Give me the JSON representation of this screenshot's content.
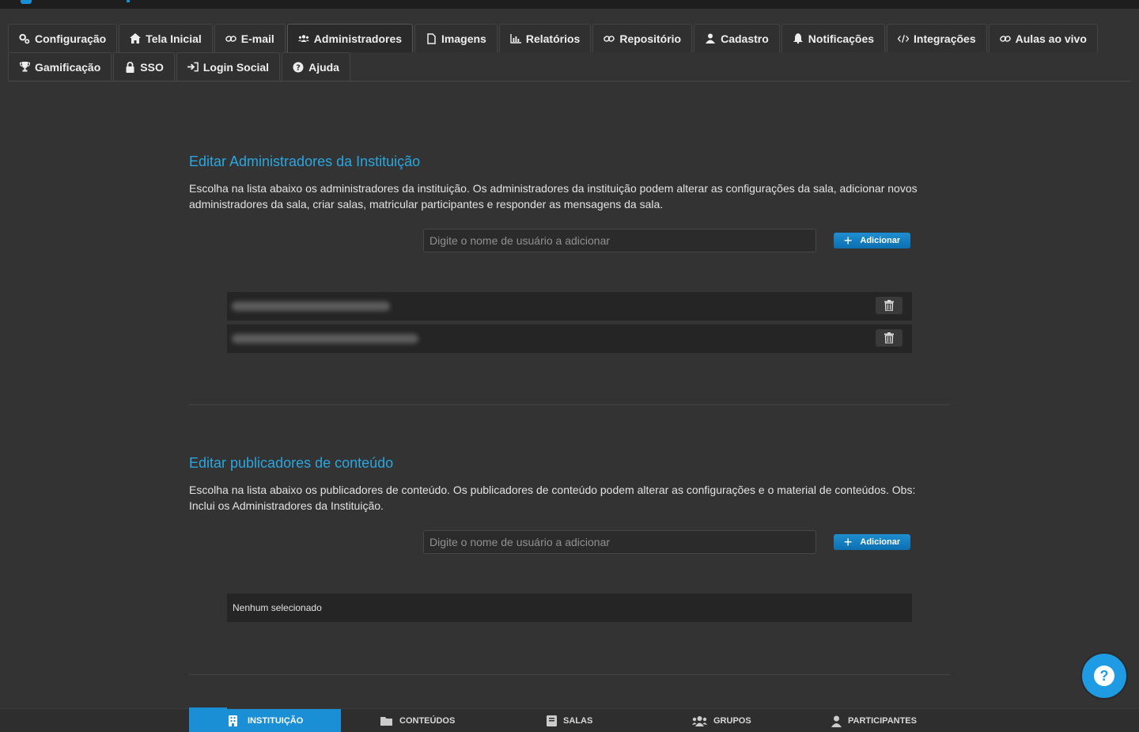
{
  "tabs": {
    "row1": [
      {
        "label": "Configuração",
        "icon": "gears-icon",
        "name": "tab-configuracao"
      },
      {
        "label": "Tela Inicial",
        "icon": "home-icon",
        "name": "tab-tela-inicial"
      },
      {
        "label": "E-mail",
        "icon": "link-icon",
        "name": "tab-email"
      },
      {
        "label": "Administradores",
        "icon": "users-icon",
        "name": "tab-administradores",
        "active": true
      },
      {
        "label": "Imagens",
        "icon": "file-icon",
        "name": "tab-imagens"
      },
      {
        "label": "Relatórios",
        "icon": "bar-chart-icon",
        "name": "tab-relatorios"
      },
      {
        "label": "Repositório",
        "icon": "link-icon",
        "name": "tab-repositorio"
      },
      {
        "label": "Cadastro",
        "icon": "user-icon",
        "name": "tab-cadastro"
      },
      {
        "label": "Notificações",
        "icon": "bell-icon",
        "name": "tab-notificacoes"
      },
      {
        "label": "Integrações",
        "icon": "code-icon",
        "name": "tab-integracoes"
      },
      {
        "label": "Aulas ao vivo",
        "icon": "link-icon",
        "name": "tab-aulas-ao-vivo"
      }
    ],
    "row2": [
      {
        "label": "Gamificação",
        "icon": "trophy-icon",
        "name": "tab-gamificacao"
      },
      {
        "label": "SSO",
        "icon": "lock-icon",
        "name": "tab-sso"
      },
      {
        "label": "Login Social",
        "icon": "sign-in-icon",
        "name": "tab-login-social"
      },
      {
        "label": "Ajuda",
        "icon": "question-circle-icon",
        "name": "tab-ajuda"
      }
    ]
  },
  "admins": {
    "title": "Editar Administradores da Instituição",
    "description": "Escolha na lista abaixo os administradores da instituição. Os administradores da instituição podem alterar as configurações da sala, adicionar novos administradores da sala, criar salas, matricular participantes e responder as mensagens da sala.",
    "placeholder": "Digite o nome de usuário a adicionar",
    "add_label": "Adicionar"
  },
  "publishers": {
    "title": "Editar publicadores de conteúdo",
    "description": "Escolha na lista abaixo os publicadores de conteúdo. Os publicadores de conteúdo podem alterar as configurações e o material de conteúdos. Obs: Inclui os Administradores da Instituição.",
    "placeholder": "Digite o nome de usuário a adicionar",
    "add_label": "Adicionar",
    "empty_text": "Nenhum selecionado"
  },
  "bottom_nav": {
    "instituicao": "INSTITUIÇÃO",
    "conteudos": "CONTEÚDOS",
    "salas": "SALAS",
    "grupos": "GRUPOS",
    "participantes": "PARTICIPANTES"
  },
  "colors": {
    "accent": "#1a8fd6",
    "heading": "#2aa6e0",
    "background": "#333333"
  }
}
